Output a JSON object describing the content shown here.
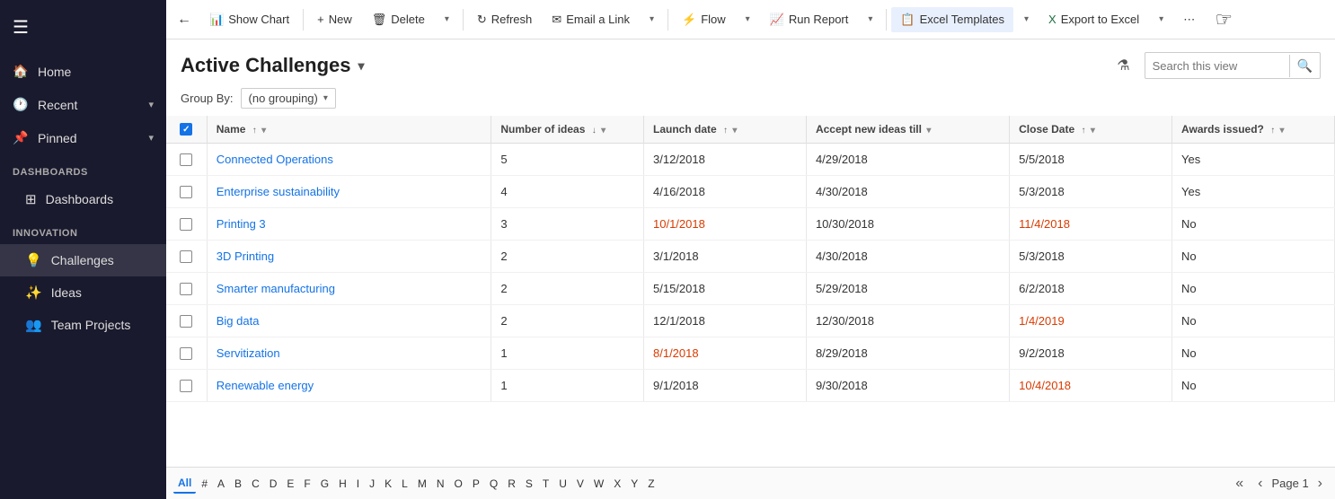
{
  "sidebar": {
    "hamburger": "☰",
    "nav_items": [
      {
        "id": "home",
        "icon": "🏠",
        "label": "Home",
        "has_chevron": false
      },
      {
        "id": "recent",
        "icon": "🕐",
        "label": "Recent",
        "has_chevron": true
      },
      {
        "id": "pinned",
        "icon": "📌",
        "label": "Pinned",
        "has_chevron": true
      }
    ],
    "sections": [
      {
        "title": "Dashboards",
        "items": [
          {
            "id": "dashboards",
            "icon": "⊞",
            "label": "Dashboards"
          }
        ]
      },
      {
        "title": "Innovation",
        "items": [
          {
            "id": "challenges",
            "icon": "💡",
            "label": "Challenges"
          },
          {
            "id": "ideas",
            "icon": "✨",
            "label": "Ideas"
          },
          {
            "id": "team-projects",
            "icon": "👥",
            "label": "Team Projects"
          }
        ]
      }
    ]
  },
  "toolbar": {
    "back_label": "←",
    "show_chart_label": "Show Chart",
    "new_label": "New",
    "delete_label": "Delete",
    "refresh_label": "Refresh",
    "email_link_label": "Email a Link",
    "flow_label": "Flow",
    "run_report_label": "Run Report",
    "excel_templates_label": "Excel Templates",
    "export_excel_label": "Export to Excel",
    "more_label": "⋯"
  },
  "header": {
    "title": "Active Challenges",
    "search_placeholder": "Search this view",
    "filter_icon": "⚗",
    "search_icon": "🔍"
  },
  "groupby": {
    "label": "Group By:",
    "value": "(no grouping)"
  },
  "table": {
    "columns": [
      {
        "id": "check",
        "label": ""
      },
      {
        "id": "name",
        "label": "Name",
        "sort": "asc",
        "has_filter": true
      },
      {
        "id": "ideas",
        "label": "Number of ideas",
        "sort": "desc",
        "has_filter": true
      },
      {
        "id": "launch",
        "label": "Launch date",
        "sort": "asc",
        "has_filter": true
      },
      {
        "id": "accept",
        "label": "Accept new ideas till",
        "sort": "none",
        "has_filter": true
      },
      {
        "id": "close",
        "label": "Close Date",
        "sort": "asc",
        "has_filter": true
      },
      {
        "id": "awards",
        "label": "Awards issued?",
        "sort": "asc",
        "has_filter": true
      }
    ],
    "rows": [
      {
        "name": "Connected Operations",
        "ideas": "5",
        "launch": "3/12/2018",
        "accept": "4/29/2018",
        "close": "5/5/2018",
        "awards": "Yes",
        "launch_overdue": false,
        "accept_overdue": false,
        "close_overdue": false
      },
      {
        "name": "Enterprise sustainability",
        "ideas": "4",
        "launch": "4/16/2018",
        "accept": "4/30/2018",
        "close": "5/3/2018",
        "awards": "Yes",
        "launch_overdue": false,
        "accept_overdue": false,
        "close_overdue": false
      },
      {
        "name": "Printing 3",
        "ideas": "3",
        "launch": "10/1/2018",
        "accept": "10/30/2018",
        "close": "11/4/2018",
        "awards": "No",
        "launch_overdue": true,
        "accept_overdue": false,
        "close_overdue": true
      },
      {
        "name": "3D Printing",
        "ideas": "2",
        "launch": "3/1/2018",
        "accept": "4/30/2018",
        "close": "5/3/2018",
        "awards": "No",
        "launch_overdue": false,
        "accept_overdue": false,
        "close_overdue": false
      },
      {
        "name": "Smarter manufacturing",
        "ideas": "2",
        "launch": "5/15/2018",
        "accept": "5/29/2018",
        "close": "6/2/2018",
        "awards": "No",
        "launch_overdue": false,
        "accept_overdue": false,
        "close_overdue": false
      },
      {
        "name": "Big data",
        "ideas": "2",
        "launch": "12/1/2018",
        "accept": "12/30/2018",
        "close": "1/4/2019",
        "awards": "No",
        "launch_overdue": false,
        "accept_overdue": false,
        "close_overdue": true
      },
      {
        "name": "Servitization",
        "ideas": "1",
        "launch": "8/1/2018",
        "accept": "8/29/2018",
        "close": "9/2/2018",
        "awards": "No",
        "launch_overdue": true,
        "accept_overdue": false,
        "close_overdue": false
      },
      {
        "name": "Renewable energy",
        "ideas": "1",
        "launch": "9/1/2018",
        "accept": "9/30/2018",
        "close": "10/4/2018",
        "awards": "No",
        "launch_overdue": false,
        "accept_overdue": false,
        "close_overdue": true
      }
    ]
  },
  "footer": {
    "alpha_buttons": [
      "All",
      "#",
      "A",
      "B",
      "C",
      "D",
      "E",
      "F",
      "G",
      "H",
      "I",
      "J",
      "K",
      "L",
      "M",
      "N",
      "O",
      "P",
      "Q",
      "R",
      "S",
      "T",
      "U",
      "V",
      "W",
      "X",
      "Y",
      "Z"
    ],
    "active_alpha": "All",
    "page_label": "Page 1",
    "prev_page": "‹",
    "next_page": "›",
    "first_page": "«",
    "last_page": "»"
  }
}
